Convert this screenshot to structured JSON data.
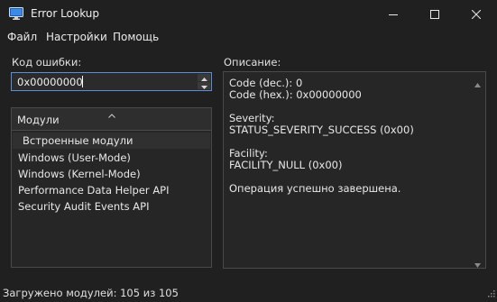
{
  "window": {
    "title": "Error Lookup",
    "icon": "monitor-icon",
    "controls": [
      "minimize-icon",
      "maximize-icon",
      "close-icon"
    ]
  },
  "menu": {
    "items": [
      "Файл",
      "Настройки",
      "Помощь"
    ]
  },
  "code_section": {
    "label": "Код ошибки:",
    "value": "0x00000000"
  },
  "modules_list": {
    "header": "Модули",
    "items": [
      {
        "label": "Встроенные модули",
        "type": "group"
      },
      {
        "label": "Windows (User-Mode)",
        "type": "item"
      },
      {
        "label": "Windows (Kernel-Mode)",
        "type": "item"
      },
      {
        "label": "Performance Data Helper API",
        "type": "item"
      },
      {
        "label": "Security Audit Events API",
        "type": "item"
      }
    ]
  },
  "description": {
    "label": "Описание:",
    "lines": [
      "Code (dec.): 0",
      "Code (hex.): 0x00000000",
      "",
      "Severity:",
      "STATUS_SEVERITY_SUCCESS (0x00)",
      "",
      "Facility:",
      "FACILITY_NULL (0x00)",
      "",
      "Операция успешно завершена."
    ]
  },
  "status_bar": {
    "text": "Загружено модулей: 105 из 105"
  },
  "colors": {
    "background": "#202020",
    "panel": "#262626",
    "focus_border": "#5a8fd6",
    "text": "#e8e8e8"
  }
}
